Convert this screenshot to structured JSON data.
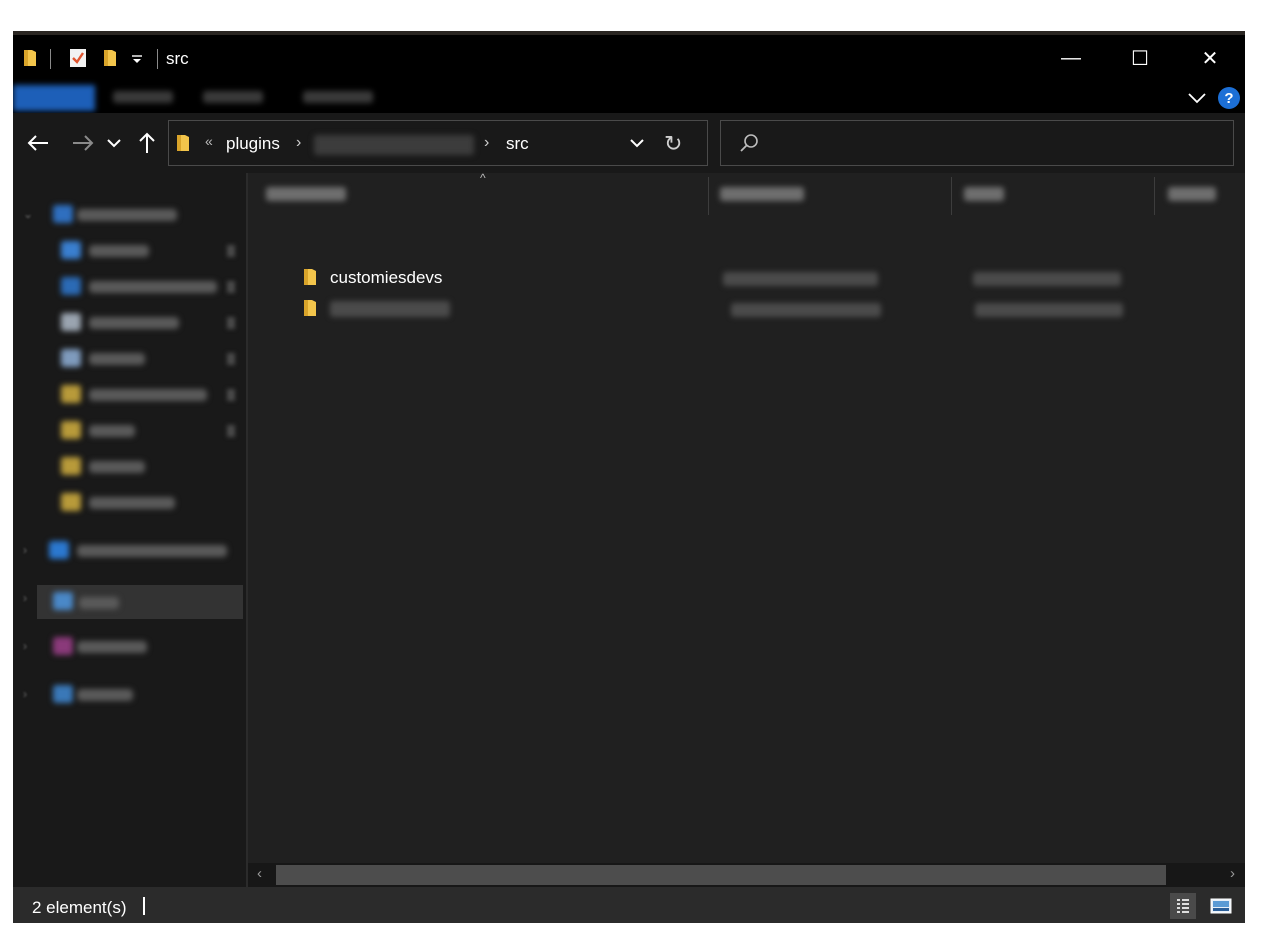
{
  "window": {
    "title": "src",
    "controls": {
      "minimize": "—",
      "maximize": "☐",
      "close": "✕"
    },
    "help_label": "?"
  },
  "address": {
    "overflow": "«",
    "segments": [
      "plugins",
      "src"
    ],
    "separator": "›",
    "refresh": "↻"
  },
  "nav": {
    "back": "←",
    "forward": "→",
    "recent": "⌄",
    "up": "↑"
  },
  "files": [
    {
      "name": "customiesdevs",
      "icon": "folder-icon"
    },
    {
      "name": "",
      "icon": "folder-icon"
    }
  ],
  "status": {
    "count": "2 element(s)"
  },
  "scroll": {
    "left": "‹",
    "right": "›"
  },
  "sort": {
    "indicator": "^"
  },
  "colors": {
    "accent": "#1c6fd6",
    "folder": "#f3c54b",
    "background": "#202020"
  }
}
